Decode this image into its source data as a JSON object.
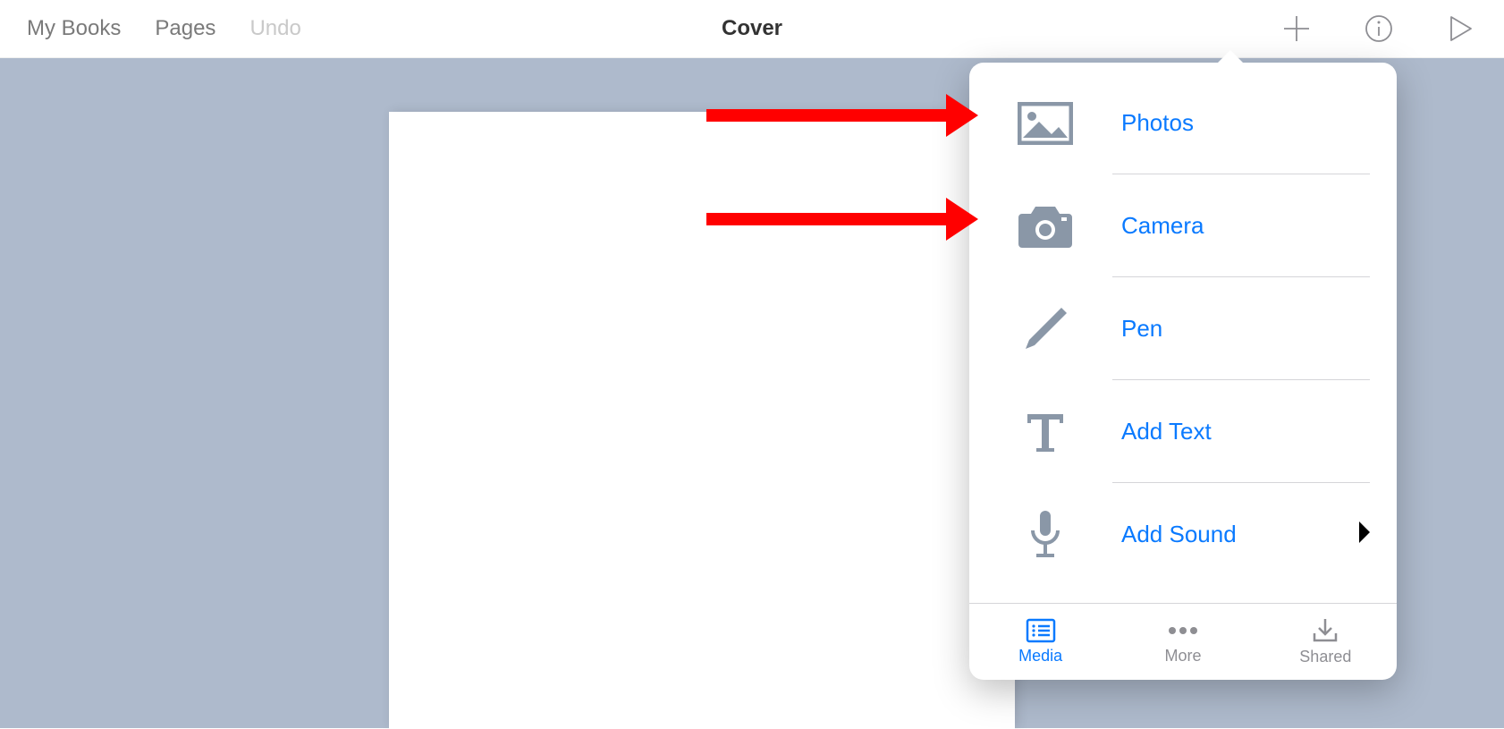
{
  "toolbar": {
    "myBooks": "My Books",
    "pages": "Pages",
    "undo": "Undo",
    "title": "Cover"
  },
  "popover": {
    "items": [
      {
        "label": "Photos"
      },
      {
        "label": "Camera"
      },
      {
        "label": "Pen"
      },
      {
        "label": "Add Text"
      },
      {
        "label": "Add Sound",
        "hasChevron": true
      }
    ],
    "tabs": {
      "media": "Media",
      "more": "More",
      "shared": "Shared"
    }
  }
}
